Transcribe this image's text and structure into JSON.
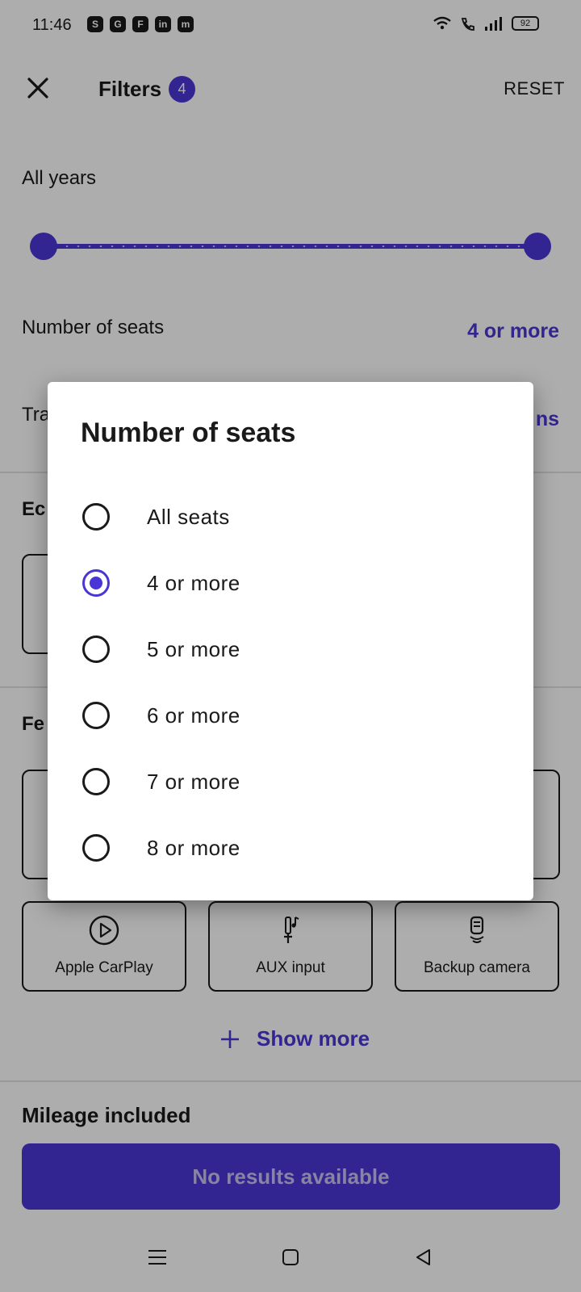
{
  "status_bar": {
    "time": "11:46",
    "apps": [
      "S",
      "G",
      "F",
      "in",
      "m"
    ],
    "battery": "92"
  },
  "header": {
    "title": "Filters",
    "badge": "4",
    "reset_label": "RESET"
  },
  "years": {
    "label": "All years"
  },
  "seats": {
    "label": "Number of seats",
    "value": "4 or more"
  },
  "transmission": {
    "label_visible": "Tra",
    "value_visible": "ns"
  },
  "sections": {
    "eco_visible": "Ec",
    "features_visible": "Fe"
  },
  "features": [
    {
      "label": "Apple CarPlay",
      "icon": "play-circle-icon"
    },
    {
      "label": "AUX input",
      "icon": "aux-jack-icon"
    },
    {
      "label": "Backup camera",
      "icon": "backup-camera-icon"
    }
  ],
  "show_more_label": "Show more",
  "mileage_label": "Mileage included",
  "results_button": "No results available",
  "dialog": {
    "title": "Number of seats",
    "options": [
      {
        "label": "All seats",
        "selected": false
      },
      {
        "label": "4 or more",
        "selected": true
      },
      {
        "label": "5 or more",
        "selected": false
      },
      {
        "label": "6 or more",
        "selected": false
      },
      {
        "label": "7 or more",
        "selected": false
      },
      {
        "label": "8 or more",
        "selected": false
      }
    ]
  },
  "colors": {
    "accent": "#4a35d6",
    "scrim": "rgba(0,0,0,0.32)"
  }
}
